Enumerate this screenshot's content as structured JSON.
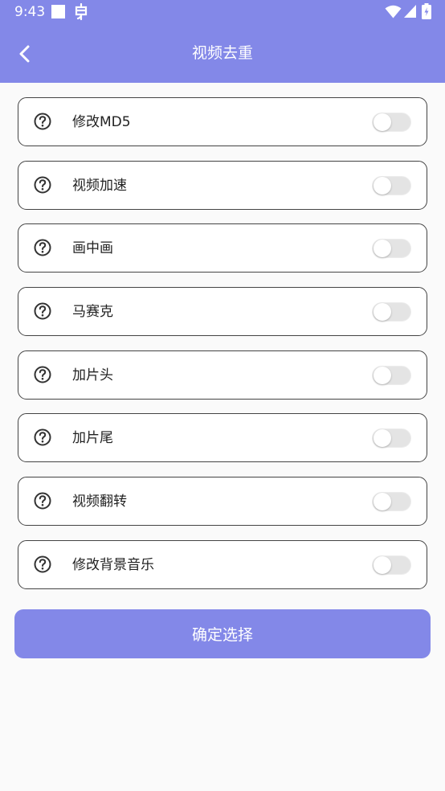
{
  "status_bar": {
    "time": "9:43"
  },
  "header": {
    "title": "视频去重",
    "background_color": "#8388e8"
  },
  "options": [
    {
      "label": "修改MD5",
      "enabled": false
    },
    {
      "label": "视频加速",
      "enabled": false
    },
    {
      "label": "画中画",
      "enabled": false
    },
    {
      "label": "马赛克",
      "enabled": false
    },
    {
      "label": "加片头",
      "enabled": false
    },
    {
      "label": "加片尾",
      "enabled": false
    },
    {
      "label": "视频翻转",
      "enabled": false
    },
    {
      "label": "修改背景音乐",
      "enabled": false
    }
  ],
  "confirm_button": {
    "label": "确定选择",
    "color": "#8388e8"
  }
}
